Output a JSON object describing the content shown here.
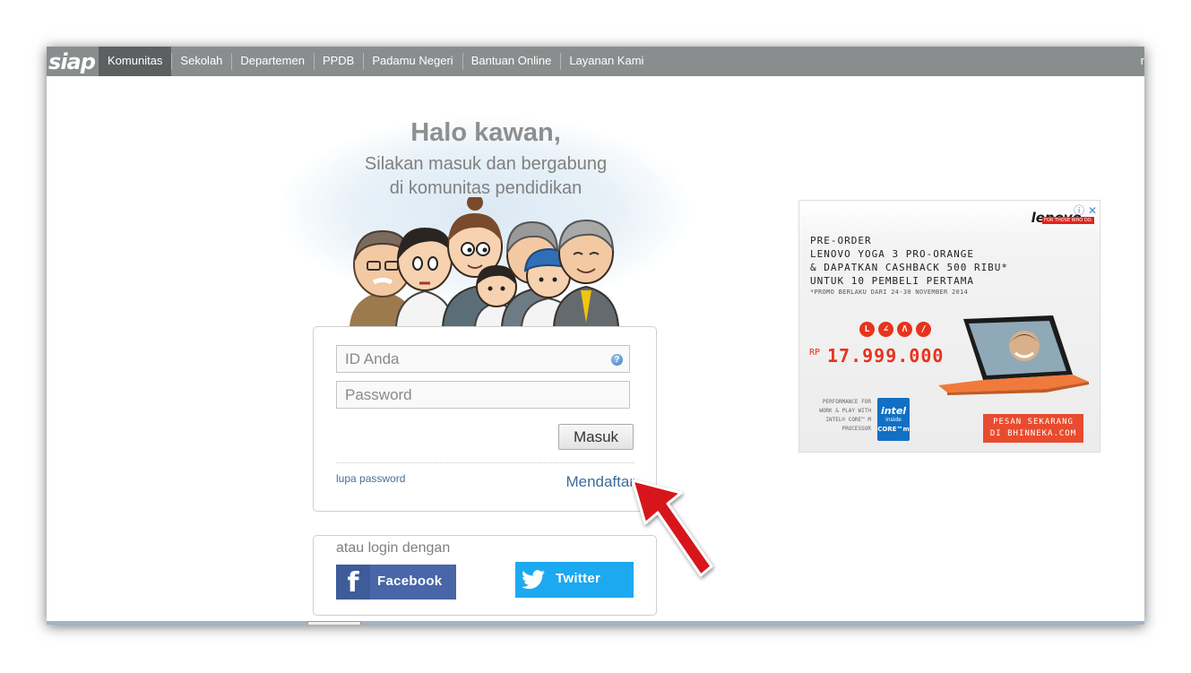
{
  "nav": {
    "logo": "siap",
    "items": [
      {
        "label": "Komunitas",
        "active": true
      },
      {
        "label": "Sekolah"
      },
      {
        "label": "Departemen"
      },
      {
        "label": "PPDB"
      },
      {
        "label": "Padamu Negeri"
      },
      {
        "label": "Bantuan Online"
      },
      {
        "label": "Layanan Kami"
      }
    ],
    "right_text": "r"
  },
  "hero": {
    "title": "Halo kawan,",
    "subtitle_line1": "Silakan masuk dan bergabung",
    "subtitle_line2": "di komunitas pendidikan"
  },
  "login": {
    "id_placeholder": "ID Anda",
    "password_placeholder": "Password",
    "submit_label": "Masuk",
    "forgot_label": "lupa password",
    "register_label": "Mendaftar"
  },
  "social": {
    "label": "atau login dengan",
    "facebook_icon_glyph": "f",
    "facebook_label": "Facebook",
    "twitter_label": "Twitter"
  },
  "ad": {
    "brand": "lenovo",
    "brand_tag": "FOR THOSE WHO DO.",
    "close_glyph": "ⓘ ✕",
    "lines": [
      "PRE-ORDER",
      "LENOVO YOGA 3 PRO-ORANGE",
      "& DAPATKAN CASHBACK 500 RIBU*",
      "UNTUK 10 PEMBELI PERTAMA"
    ],
    "promo_note": "*PROMO BERLAKU DARI 24-30 NOVEMBER 2014",
    "mode_letters": [
      "L",
      "∠",
      "Λ",
      "/"
    ],
    "price_prefix": "RP",
    "price": "17.999.000",
    "performance_note": "PERFORMANCE FOR WORK & PLAY WITH INTEL® CORE™ M PROCESSOR",
    "intel_brand": "intel",
    "intel_inside": "inside",
    "intel_core": "CORE™m",
    "cta_line1": "PESAN SEKARANG",
    "cta_line2": "DI BHINNEKA.COM"
  },
  "colors": {
    "nav_bg": "#8a8d8e",
    "nav_active": "#5d6061",
    "facebook": "#4866a8",
    "twitter": "#1da9f0",
    "accent_red": "#e8321d",
    "link": "#3e6a99"
  }
}
